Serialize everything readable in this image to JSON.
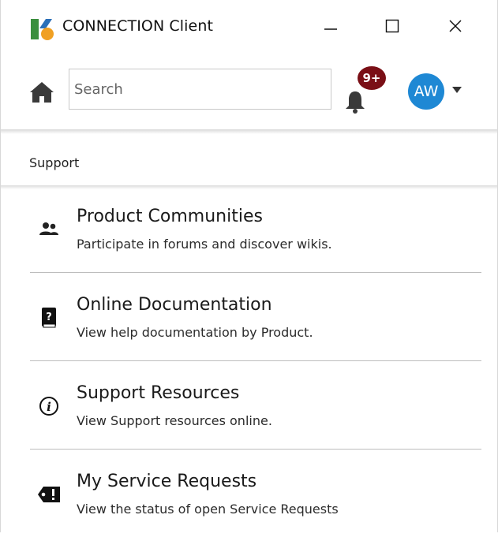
{
  "window": {
    "title": "CONNECTION Client",
    "app_icon": "connection-logo-icon",
    "controls": [
      "minimize-icon",
      "maximize-icon",
      "close-icon"
    ]
  },
  "toolbar": {
    "home_icon": "home-icon",
    "search": {
      "placeholder": "Search",
      "value": ""
    },
    "notifications": {
      "icon": "bell-icon",
      "badge": "9+",
      "badge_color": "#7a0f16"
    },
    "user": {
      "initials": "AW",
      "color": "#1e88d4",
      "menu_icon": "caret-down-icon"
    }
  },
  "section": {
    "title": "Support"
  },
  "items": [
    {
      "icon": "people-icon",
      "title": "Product Communities",
      "description": "Participate in forums and discover wikis."
    },
    {
      "icon": "help-book-icon",
      "title": "Online Documentation",
      "description": "View help documentation by Product."
    },
    {
      "icon": "info-icon",
      "title": "Support Resources",
      "description": "View Support resources online."
    },
    {
      "icon": "service-ticket-icon",
      "title": "My Service Requests",
      "description": "View the status of open Service Requests"
    }
  ]
}
